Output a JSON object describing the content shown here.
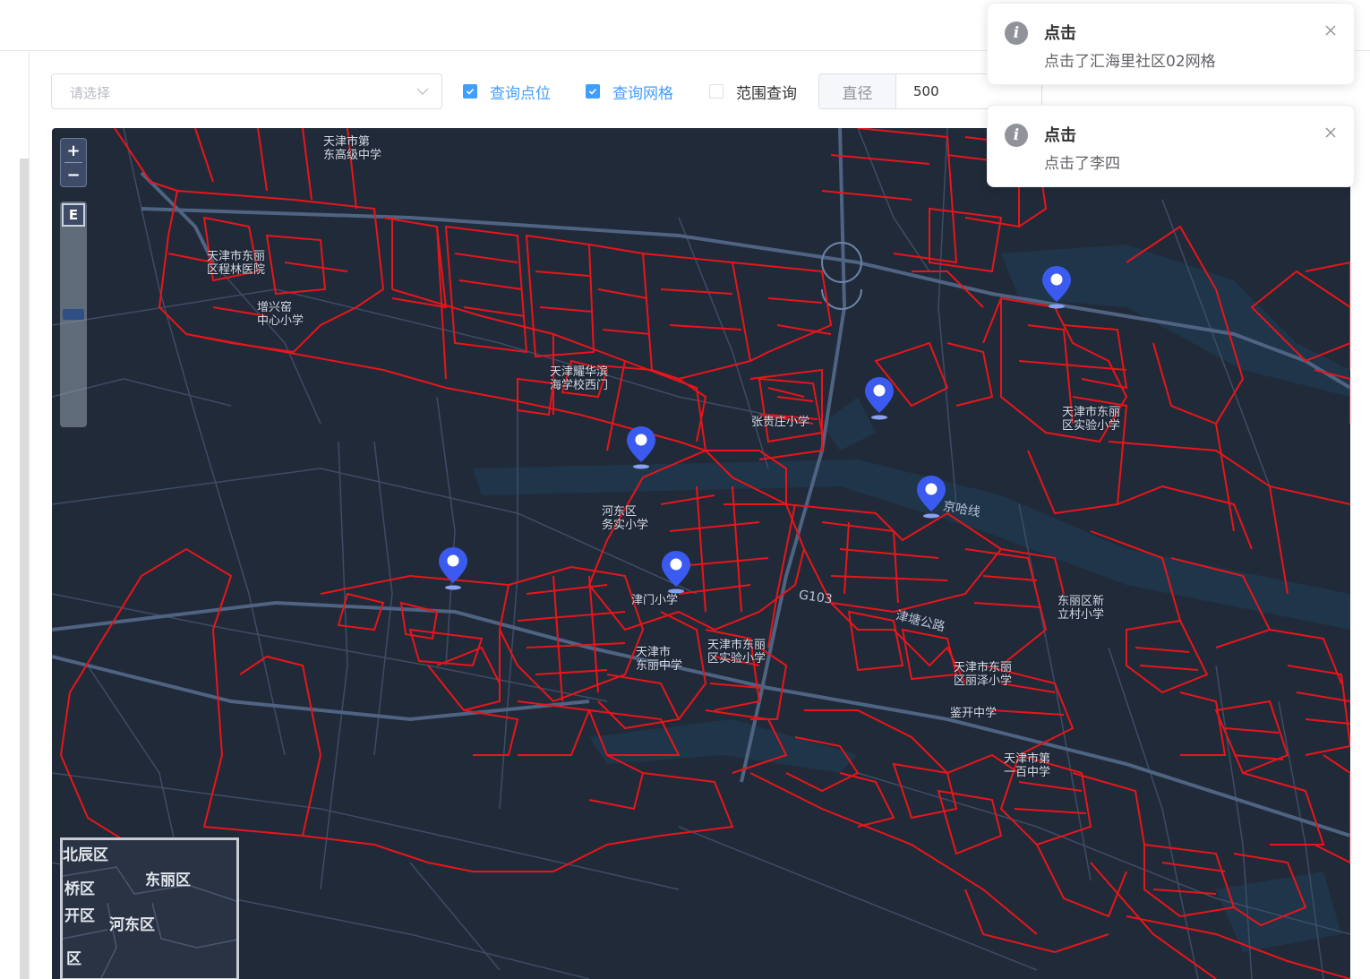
{
  "filters": {
    "select_placeholder": "请选择",
    "checkbox_points": {
      "label": "查询点位",
      "checked": true
    },
    "checkbox_grid": {
      "label": "查询网格",
      "checked": true
    },
    "checkbox_range": {
      "label": "范围查询",
      "checked": false
    },
    "diameter": {
      "label": "直径",
      "value": "500"
    }
  },
  "map": {
    "zoom_in": "+",
    "zoom_out": "−",
    "eagle_button": "E",
    "labels": [
      "天津市第\n东高级中学",
      "天津市东丽\n区程林医院",
      "增兴窑\n中心小学",
      "天津耀华滨\n海学校西门",
      "张贵庄小学",
      "天津市东丽\n区实验小学",
      "河东区\n务实小学",
      "津门小学",
      "天津市\n东丽中学",
      "天津市东丽\n区实验小学",
      "东丽区新\n立村小学",
      "天津市东丽\n区丽泽小学",
      "鉴开中学",
      "天津市第\n一百中学"
    ],
    "road_labels": [
      "京哈线",
      "G103",
      "津塘公路"
    ],
    "overview_labels": [
      "北辰区",
      "东丽区",
      "桥区",
      "开区",
      "河东区",
      "区"
    ],
    "pin_count": 6
  },
  "notifications": [
    {
      "title": "点击",
      "message": "点击了汇海里社区02网格",
      "icon": "info-icon"
    },
    {
      "title": "点击",
      "message": "点击了李四",
      "icon": "info-icon"
    }
  ],
  "colors": {
    "primary": "#409eff",
    "map_bg": "#212a38",
    "grid_line": "#e8151b",
    "pin": "#3b5bf0"
  }
}
